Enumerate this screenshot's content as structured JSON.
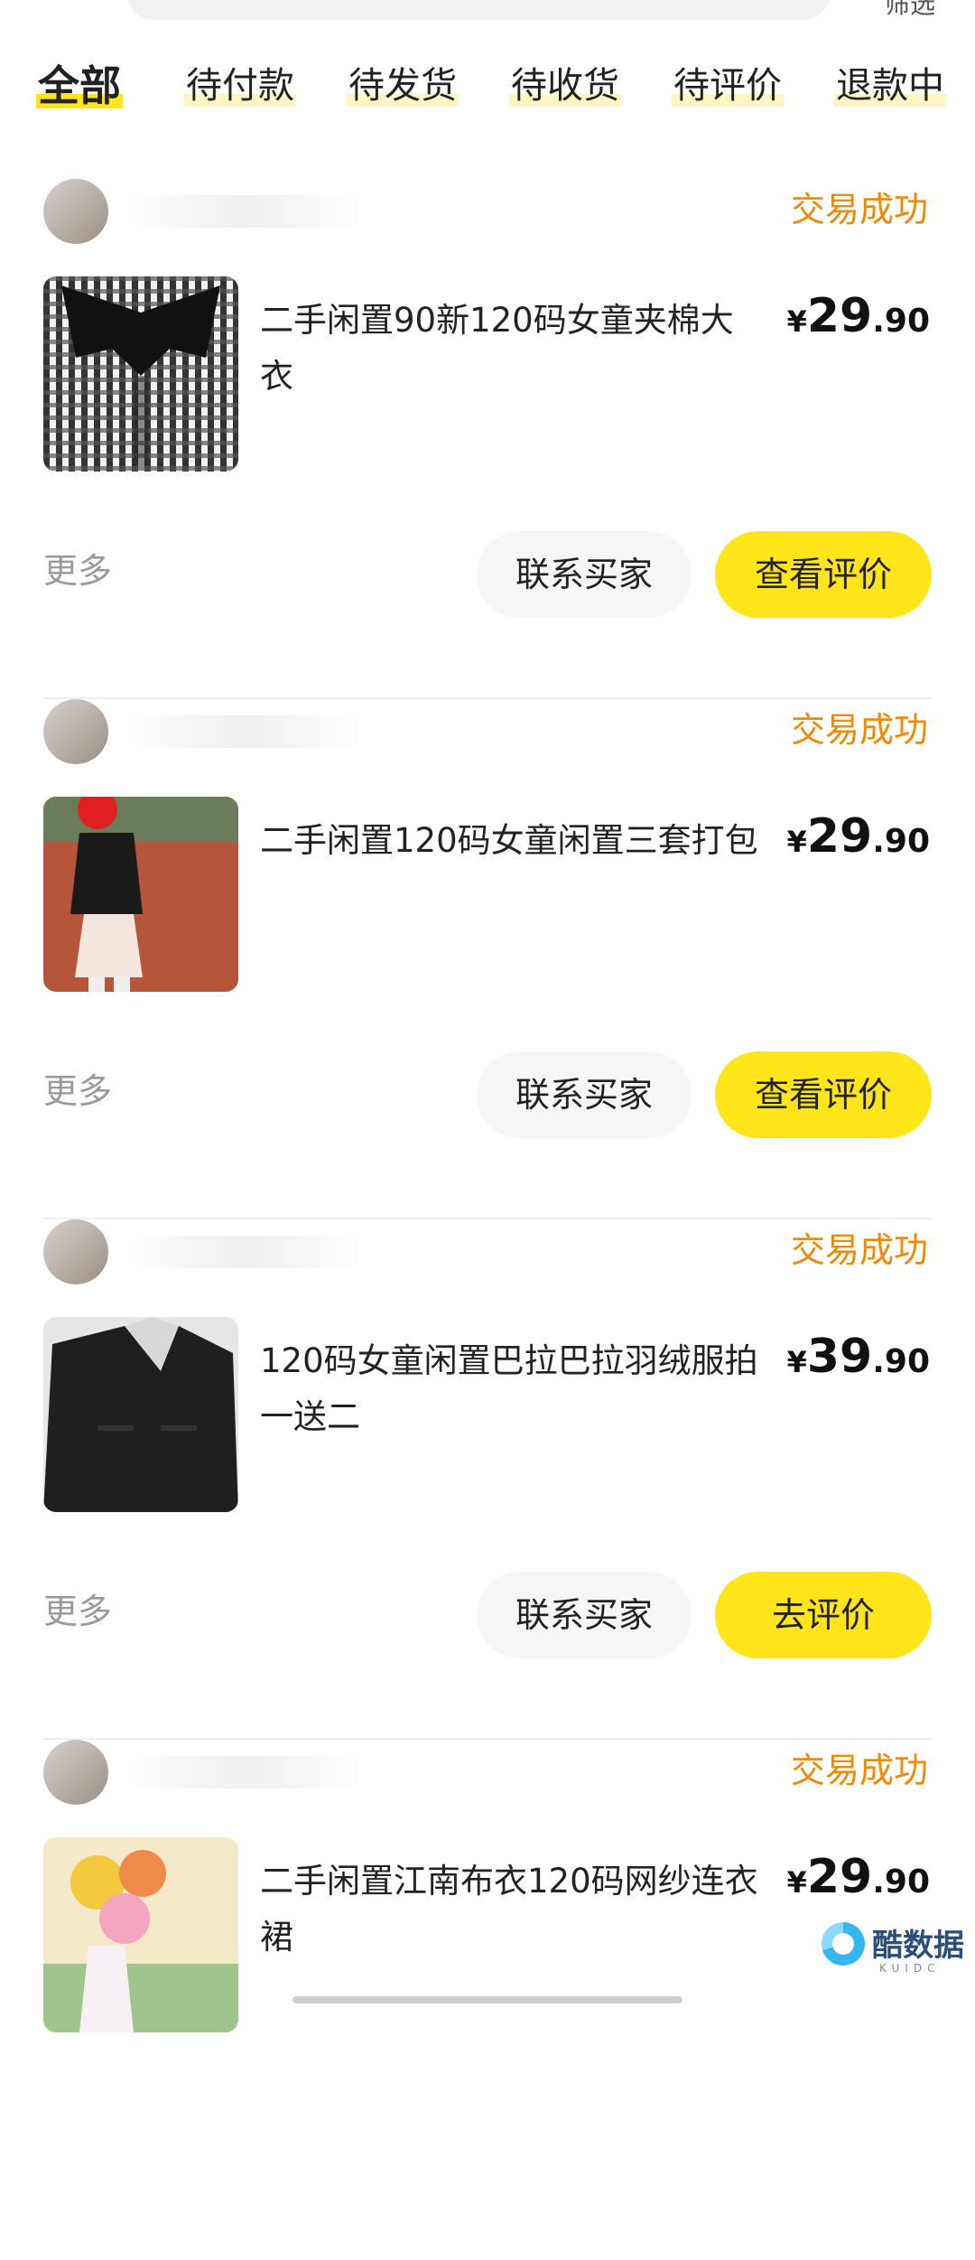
{
  "header": {
    "filter_label": "筛选"
  },
  "tabs": [
    {
      "label": "全部",
      "active": true
    },
    {
      "label": "待付款"
    },
    {
      "label": "待发货"
    },
    {
      "label": "待收货"
    },
    {
      "label": "待评价"
    },
    {
      "label": "退款中"
    }
  ],
  "orders": [
    {
      "status": "交易成功",
      "title": "二手闲置90新120码女童夹棉大衣",
      "price_currency": "¥",
      "price_int": "29",
      "price_dec": ".90",
      "more": "更多",
      "contact_btn": "联系买家",
      "action_btn": "查看评价"
    },
    {
      "status": "交易成功",
      "title": "二手闲置120码女童闲置三套打包",
      "price_currency": "¥",
      "price_int": "29",
      "price_dec": ".90",
      "more": "更多",
      "contact_btn": "联系买家",
      "action_btn": "查看评价"
    },
    {
      "status": "交易成功",
      "title": "120码女童闲置巴拉巴拉羽绒服拍一送二",
      "price_currency": "¥",
      "price_int": "39",
      "price_dec": ".90",
      "more": "更多",
      "contact_btn": "联系买家",
      "action_btn": "去评价"
    },
    {
      "status": "交易成功",
      "title": "二手闲置江南布衣120码网纱连衣裙",
      "price_currency": "¥",
      "price_int": "29",
      "price_dec": ".90"
    }
  ],
  "watermark": {
    "text": "酷数据",
    "sub": "KUIDC"
  },
  "colors": {
    "accent_yellow": "#ffe51a",
    "status_orange": "#f08a00"
  }
}
